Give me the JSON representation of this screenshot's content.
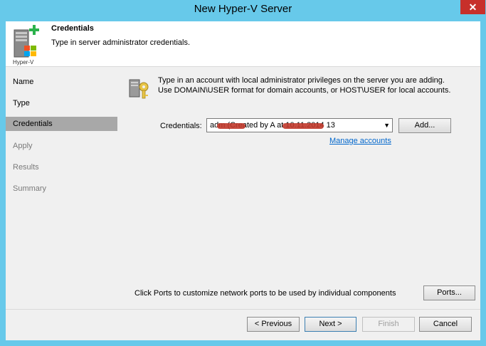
{
  "window": {
    "title": "New Hyper-V Server",
    "close_glyph": "✕"
  },
  "header": {
    "title": "Credentials",
    "subtitle": "Type in server administrator credentials.",
    "icon_caption": "Hyper-V"
  },
  "sidebar": {
    "items": [
      {
        "label": "Name",
        "state": "done"
      },
      {
        "label": "Type",
        "state": "done"
      },
      {
        "label": "Credentials",
        "state": "active"
      },
      {
        "label": "Apply",
        "state": "disabled"
      },
      {
        "label": "Results",
        "state": "disabled"
      },
      {
        "label": "Summary",
        "state": "disabled"
      }
    ]
  },
  "main": {
    "intro_line1": "Type in an account with local administrator privileges on the server you are adding.",
    "intro_line2": "Use DOMAIN\\USER format for domain accounts, or HOST\\USER for local accounts.",
    "credentials_label": "Credentials:",
    "credentials_value": "adm     (Created by A    at 10.11.2014 13",
    "add_button": "Add...",
    "manage_link": "Manage accounts",
    "ports_text": "Click Ports to customize network ports to be used by individual components",
    "ports_button": "Ports..."
  },
  "footer": {
    "previous": "< Previous",
    "next": "Next >",
    "finish": "Finish",
    "cancel": "Cancel"
  },
  "colors": {
    "accent": "#67c9ea",
    "active_nav": "#a8a8a8",
    "link": "#0066cc",
    "close": "#c7302a"
  }
}
